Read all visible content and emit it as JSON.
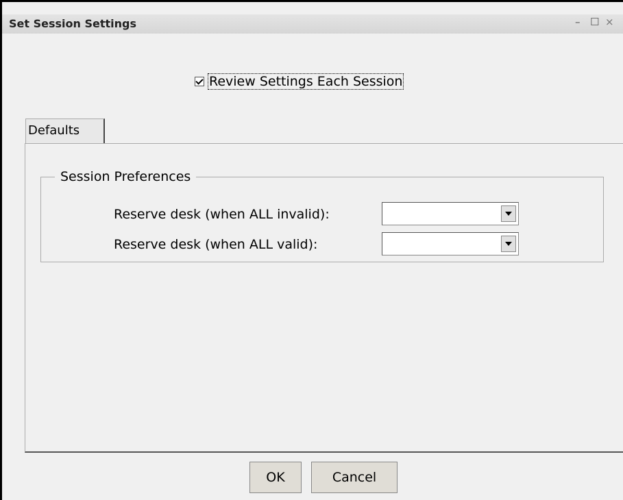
{
  "window": {
    "title": "Set Session Settings",
    "min_glyph": "–",
    "max_glyph": "☐",
    "close_glyph": "×"
  },
  "review": {
    "label": "Review Settings Each Session",
    "checked": true
  },
  "tabs": [
    {
      "label": "Defaults"
    }
  ],
  "group": {
    "legend": "Session Preferences",
    "rows": [
      {
        "label": "Reserve desk (when ALL invalid):",
        "value": ""
      },
      {
        "label": "Reserve desk (when ALL valid):",
        "value": ""
      }
    ]
  },
  "buttons": {
    "ok": "OK",
    "cancel": "Cancel"
  }
}
